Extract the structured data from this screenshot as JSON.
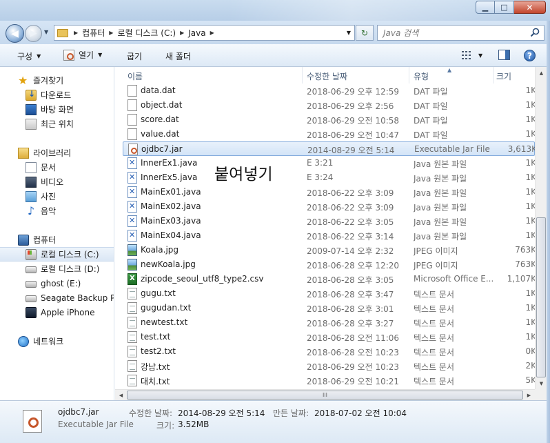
{
  "window": {
    "minimize_glyph": "▁",
    "maximize_glyph": "□",
    "close_glyph": "✕"
  },
  "address": {
    "crumbs": [
      "컴퓨터",
      "로컬 디스크 (C:)",
      "Java"
    ],
    "search_placeholder": "Java 검색"
  },
  "toolbar": {
    "organize": "구성",
    "open": "열기",
    "share": "굽기",
    "new_folder": "새 폴더",
    "help": "?"
  },
  "nav": {
    "favorites": "즐겨찾기",
    "downloads": "다운로드",
    "desktop": "바탕 화면",
    "recent": "최근 위치",
    "libraries": "라이브러리",
    "documents": "문서",
    "videos": "비디오",
    "pictures": "사진",
    "music": "음악",
    "computer": "컴퓨터",
    "local_c": "로컬 디스크 (C:)",
    "local_d": "로컬 디스크 (D:)",
    "ghost_e": "ghost (E:)",
    "seagate": "Seagate Backup Plu",
    "iphone": "Apple iPhone",
    "network": "네트워크"
  },
  "columns": {
    "name": "이름",
    "date": "수정한 날짜",
    "type": "유형",
    "size": "크기"
  },
  "files": [
    {
      "name": "data.dat",
      "date": "2018-06-29 오후 12:59",
      "type": "DAT 파일",
      "size": "1K",
      "icon": "blank"
    },
    {
      "name": "object.dat",
      "date": "2018-06-29 오후 2:56",
      "type": "DAT 파일",
      "size": "1K",
      "icon": "blank"
    },
    {
      "name": "score.dat",
      "date": "2018-06-29 오전 10:58",
      "type": "DAT 파일",
      "size": "1K",
      "icon": "blank"
    },
    {
      "name": "value.dat",
      "date": "2018-06-29 오전 10:47",
      "type": "DAT 파일",
      "size": "1K",
      "icon": "blank"
    },
    {
      "name": "ojdbc7.jar",
      "date": "2014-08-29 오전 5:14",
      "type": "Executable Jar File",
      "size": "3,613K",
      "icon": "jar"
    },
    {
      "name": "InnerEx1.java",
      "date": "E 3:21",
      "type": "Java 원본 파일",
      "size": "1K",
      "icon": "java"
    },
    {
      "name": "InnerEx5.java",
      "date": "E 3:24",
      "type": "Java 원본 파일",
      "size": "1K",
      "icon": "java"
    },
    {
      "name": "MainEx01.java",
      "date": "2018-06-22 오후 3:09",
      "type": "Java 원본 파일",
      "size": "1K",
      "icon": "java"
    },
    {
      "name": "MainEx02.java",
      "date": "2018-06-22 오후 3:09",
      "type": "Java 원본 파일",
      "size": "1K",
      "icon": "java"
    },
    {
      "name": "MainEx03.java",
      "date": "2018-06-22 오후 3:05",
      "type": "Java 원본 파일",
      "size": "1K",
      "icon": "java"
    },
    {
      "name": "MainEx04.java",
      "date": "2018-06-22 오후 3:14",
      "type": "Java 원본 파일",
      "size": "1K",
      "icon": "java"
    },
    {
      "name": "Koala.jpg",
      "date": "2009-07-14 오후 2:32",
      "type": "JPEG 이미지",
      "size": "763K",
      "icon": "img"
    },
    {
      "name": "newKoala.jpg",
      "date": "2018-06-28 오후 12:20",
      "type": "JPEG 이미지",
      "size": "763K",
      "icon": "img"
    },
    {
      "name": "zipcode_seoul_utf8_type2.csv",
      "date": "2018-06-28 오후 3:05",
      "type": "Microsoft Office E...",
      "size": "1,107K",
      "icon": "csv"
    },
    {
      "name": "gugu.txt",
      "date": "2018-06-28 오후 3:47",
      "type": "텍스트 문서",
      "size": "1K",
      "icon": "txt"
    },
    {
      "name": "gugudan.txt",
      "date": "2018-06-28 오후 3:01",
      "type": "텍스트 문서",
      "size": "1K",
      "icon": "txt"
    },
    {
      "name": "newtest.txt",
      "date": "2018-06-28 오후 3:27",
      "type": "텍스트 문서",
      "size": "1K",
      "icon": "txt"
    },
    {
      "name": "test.txt",
      "date": "2018-06-28 오전 11:06",
      "type": "텍스트 문서",
      "size": "1K",
      "icon": "txt"
    },
    {
      "name": "test2.txt",
      "date": "2018-06-28 오전 10:23",
      "type": "텍스트 문서",
      "size": "0K",
      "icon": "txt"
    },
    {
      "name": "강남.txt",
      "date": "2018-06-29 오전 10:23",
      "type": "텍스트 문서",
      "size": "2K",
      "icon": "txt"
    },
    {
      "name": "대치.txt",
      "date": "2018-06-29 오전 10:21",
      "type": "텍스트 문서",
      "size": "5K",
      "icon": "txt"
    }
  ],
  "overlay": {
    "paste_text": "붙여넣기"
  },
  "details": {
    "name": "ojdbc7.jar",
    "type": "Executable Jar File",
    "modified_label": "수정한 날짜:",
    "modified_value": "2014-08-29 오전 5:14",
    "created_label": "만든 날짜:",
    "created_value": "2018-07-02 오전 10:04",
    "size_label": "크기:",
    "size_value": "3.52MB"
  },
  "hscroll_grip": "III"
}
